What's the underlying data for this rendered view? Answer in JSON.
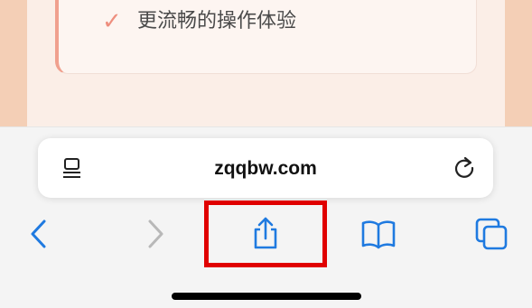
{
  "content": {
    "feature_item": "更流畅的操作体验",
    "check_icon": "checkmark-icon"
  },
  "browser": {
    "url": "zqqbw.com",
    "reader_icon": "reader-mode-icon",
    "reload_icon": "reload-icon",
    "toolbar_icons": [
      "back-icon",
      "forward-icon",
      "share-icon",
      "bookmarks-icon",
      "tabs-icon"
    ]
  },
  "colors": {
    "accent_blue": "#1f7ae0",
    "disabled_gray": "#b8b8b8",
    "highlight_red": "#e00000",
    "check_salmon": "#ee8e7e"
  }
}
